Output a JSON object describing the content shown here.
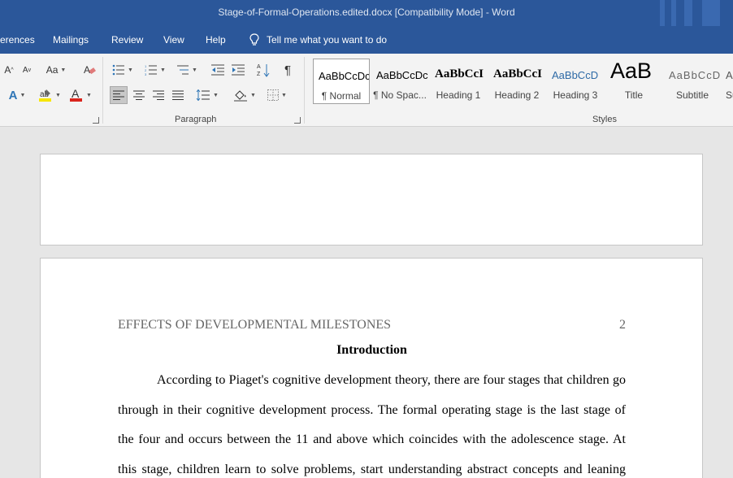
{
  "window": {
    "title": "Stage-of-Formal-Operations.edited.docx [Compatibility Mode]  -  Word"
  },
  "tabs": [
    "erences",
    "Mailings",
    "Review",
    "View",
    "Help"
  ],
  "tell_me": "Tell me what you want to do",
  "ribbon": {
    "font_buttons": {
      "grow": "A",
      "shrink": "A",
      "case": "Aa"
    },
    "paragraph_label": "Paragraph",
    "styles_label": "Styles",
    "styles": [
      {
        "sample": "AaBbCcDc",
        "name": "¶ Normal"
      },
      {
        "sample": "AaBbCcDc",
        "name": "¶ No Spac..."
      },
      {
        "sample": "AaBbCcI",
        "name": "Heading 1"
      },
      {
        "sample": "AaBbCcI",
        "name": "Heading 2"
      },
      {
        "sample": "AaBbCcD",
        "name": "Heading 3"
      },
      {
        "sample": "AaB",
        "name": "Title"
      },
      {
        "sample": "AaBbCcD",
        "name": "Subtitle"
      },
      {
        "sample": "A",
        "name": "Su"
      }
    ],
    "accent_colors": {
      "highlight": "#f7e600",
      "font_color": "#d9251d",
      "text_effects": "#2e75b6"
    }
  },
  "document": {
    "header_text": "EFFECTS OF DEVELOPMENTAL MILESTONES",
    "page_number": "2",
    "heading": "Introduction",
    "lines": [
      "According to Piaget's cognitive development theory, there are four stages that children go",
      "through in their cognitive development process. The formal operating stage is the last stage of",
      "the four and occurs between the 11 and above which coincides with the adolescence stage.  At",
      "this stage, children learn to solve problems, start understanding abstract concepts and leaning"
    ]
  }
}
